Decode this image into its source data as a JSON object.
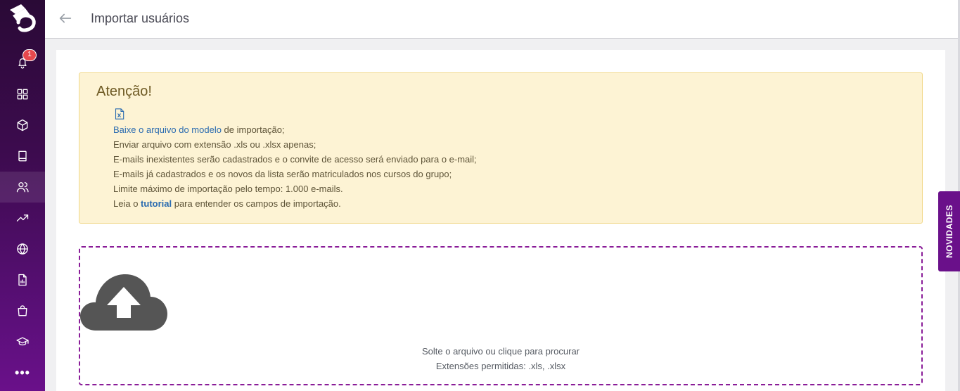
{
  "header": {
    "title": "Importar usuários"
  },
  "sidebar": {
    "notification_count": "1",
    "more_label": "•••",
    "items": [
      {
        "icon": "bell-icon"
      },
      {
        "icon": "grid-icon"
      },
      {
        "icon": "box-icon"
      },
      {
        "icon": "book-icon"
      },
      {
        "icon": "users-icon"
      },
      {
        "icon": "trending-up-icon"
      },
      {
        "icon": "globe-icon"
      },
      {
        "icon": "report-file-icon"
      },
      {
        "icon": "shopping-bag-icon"
      },
      {
        "icon": "graduation-cap-icon"
      },
      {
        "icon": "more-icon"
      }
    ]
  },
  "alert": {
    "title": "Atenção!",
    "download_link": "Baixe o arquivo do modelo",
    "download_suffix": " de importação;",
    "line2": "Enviar arquivo com extensão .xls ou .xlsx apenas;",
    "line3": "E-mails inexistentes serão cadastrados e o convite de acesso será enviado para o e-mail;",
    "line4": "E-mails já cadastrados e os novos da lista serão matriculados nos cursos do grupo;",
    "line5": "Limite máximo de importação pelo tempo: 1.000 e-mails.",
    "line6_prefix": "Leia o ",
    "tutorial_link": "tutorial",
    "line6_suffix": " para entender os campos de importação."
  },
  "dropzone": {
    "instruction": "Solte o arquivo ou clique para procurar",
    "extensions": "Extensões permitidas: .xls, .xlsx"
  },
  "novidades_tab": {
    "label": "NOVIDADES"
  },
  "colors": {
    "sidebar_top": "#2a0a36",
    "sidebar_bottom": "#6a108a",
    "alert_bg": "#fdf3d4",
    "dropzone_border": "#8a1c98",
    "link": "#2a6bb0"
  }
}
